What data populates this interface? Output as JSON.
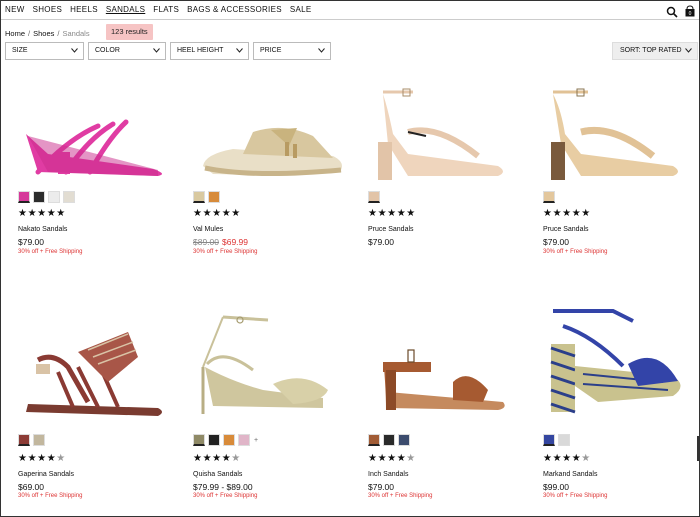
{
  "nav": {
    "items": [
      "NEW",
      "SHOES",
      "HEELS",
      "SANDALS",
      "FLATS",
      "BAGS & ACCESSORIES",
      "SALE"
    ],
    "active": "SANDALS",
    "bag_count": "0"
  },
  "breadcrumb": {
    "home": "Home",
    "shoes": "Shoes",
    "current": "Sandals"
  },
  "results": "123 results",
  "filters": {
    "size": "SIZE",
    "color": "COLOR",
    "heel": "HEEL HEIGHT",
    "price": "PRICE",
    "sort": "SORT: TOP RATED"
  },
  "products": [
    {
      "name": "Nakato Sandals",
      "price": "$79.00",
      "promo": "30% off + Free Shipping",
      "stars": "★★★★★",
      "half": "",
      "swatches": [
        "#d6399a",
        "#2c2c2c",
        "#ececec",
        "#e2ddd2"
      ],
      "shoe_color": "#e03ca3"
    },
    {
      "name": "Val Mules",
      "price_old": "$89.00",
      "price_sale": "$69.99",
      "promo": "30% off + Free Shipping",
      "stars": "★★★★★",
      "half": "",
      "swatches": [
        "#d9c9a0",
        "#d78b3b"
      ],
      "shoe_color": "#dcc9a0"
    },
    {
      "name": "Pruce Sandals",
      "price": "$79.00",
      "promo": "",
      "stars": "★★★★★",
      "half": "",
      "swatches": [
        "#e2c4a8"
      ],
      "shoe_color": "#e6c8ad"
    },
    {
      "name": "Pruce Sandals",
      "price": "$79.00",
      "promo": "30% off + Free Shipping",
      "stars": "★★★★★",
      "half": "",
      "swatches": [
        "#e3c79d"
      ],
      "shoe_color": "#e1c296"
    },
    {
      "name": "Gaperina Sandals",
      "price": "$69.00",
      "promo": "30% off + Free Shipping",
      "stars": "★★★★",
      "half": "★",
      "swatches": [
        "#8c3b35",
        "#c2b79e"
      ],
      "shoe_color": "#8a3a33"
    },
    {
      "name": "Quisha Sandals",
      "price": "$79.99 - $89.00",
      "promo": "30% off + Free Shipping",
      "stars": "★★★★",
      "half": "★",
      "swatches": [
        "#8f8a66",
        "#222222",
        "#d88b3a",
        "#e0b5c8"
      ],
      "more": "+",
      "shoe_color": "#c9c19a"
    },
    {
      "name": "Inch Sandals",
      "price": "$79.00",
      "promo": "30% off + Free Shipping",
      "stars": "★★★★",
      "half": "★",
      "swatches": [
        "#a15c35",
        "#2a2a2a",
        "#3c4c6e"
      ],
      "shoe_color": "#a65a31"
    },
    {
      "name": "Markand Sandals",
      "price": "$99.00",
      "promo": "30% off + Free Shipping",
      "stars": "★★★★",
      "half": "★",
      "swatches": [
        "#3446a0",
        "#d9d9d9"
      ],
      "shoe_color": "#3344a8"
    }
  ]
}
